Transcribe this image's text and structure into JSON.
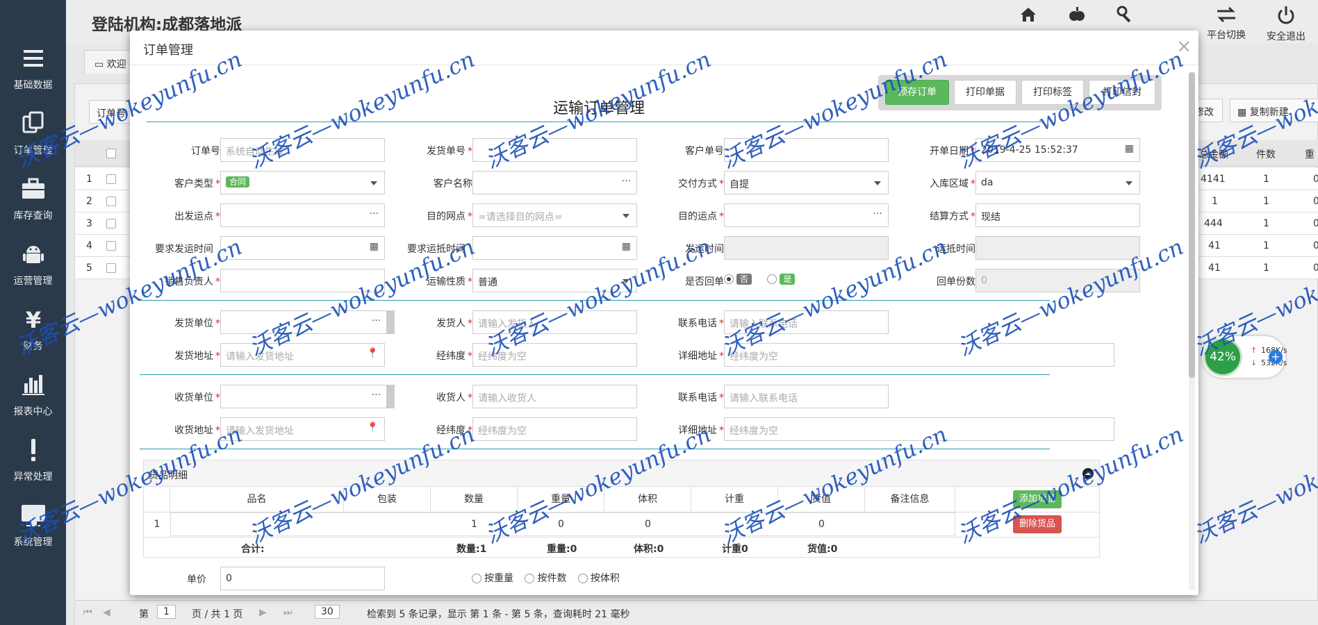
{
  "topbar": {
    "org": "登陆机构:成都落地派",
    "buttons": [
      {
        "label": ""
      },
      {
        "label": ""
      },
      {
        "label": ""
      },
      {
        "label": "平台切换"
      },
      {
        "label": "安全退出"
      }
    ]
  },
  "sidebar": {
    "items": [
      {
        "label": "基础数据",
        "icon": "menu-icon"
      },
      {
        "label": "订单管理",
        "icon": "orders-icon"
      },
      {
        "label": "库存查询",
        "icon": "briefcase-icon"
      },
      {
        "label": "运营管理",
        "icon": "android-icon"
      },
      {
        "label": "财务",
        "icon": "yen-icon"
      },
      {
        "label": "报表中心",
        "icon": "bar-chart-icon"
      },
      {
        "label": "异常处理",
        "icon": "exclamation-icon"
      },
      {
        "label": "系统管理",
        "icon": "monitor-icon"
      }
    ]
  },
  "background": {
    "tab": "欢迎",
    "filter_label": "订单号",
    "right_buttons": [
      "修改",
      "复制新建"
    ],
    "columns": [
      "总金额",
      "件数",
      "重"
    ],
    "rows": [
      {
        "no": "1",
        "amount": "4141",
        "count": "1",
        "w": "0"
      },
      {
        "no": "2",
        "amount": "1",
        "count": "1",
        "w": "0"
      },
      {
        "no": "3",
        "amount": "444",
        "count": "1",
        "w": "0"
      },
      {
        "no": "4",
        "amount": "41",
        "count": "1",
        "w": "0"
      },
      {
        "no": "5",
        "amount": "41",
        "count": "1",
        "w": "0"
      }
    ],
    "pager": {
      "page_prefix": "第",
      "page": "1",
      "page_suffix": "页 / 共 1 页",
      "size": "30",
      "summary": "检索到 5 条记录，显示 第 1 条 - 第 5 条，查询耗时 21 毫秒"
    }
  },
  "network": {
    "percent": "42%",
    "up": "168K/s",
    "down": "532K/s"
  },
  "modal": {
    "title": "订单管理",
    "close": "×",
    "actions": [
      "预存订单",
      "打印单据",
      "打印标签",
      "打印信封"
    ],
    "form_title": "运输订单管理",
    "fields": {
      "order_no": {
        "label": "订单号",
        "placeholder": "系统自动生成"
      },
      "ship_no": {
        "label": "发货单号",
        "value": ""
      },
      "cust_no": {
        "label": "客户单号",
        "value": ""
      },
      "open_date": {
        "label": "开单日期",
        "value": "2019-4-25 15:52:37"
      },
      "cust_type": {
        "label": "客户类型",
        "value": "合同"
      },
      "cust_name": {
        "label": "客户名称",
        "suffix": "···"
      },
      "pay_mode": {
        "label": "交付方式",
        "value": "自提"
      },
      "in_area": {
        "label": "入库区域",
        "value": "da"
      },
      "from_site": {
        "label": "出发运点",
        "suffix": "···"
      },
      "dest_net": {
        "label": "目的网点",
        "placeholder": "=请选择目的网点="
      },
      "dest_site": {
        "label": "目的运点",
        "suffix": "···"
      },
      "settle": {
        "label": "结算方式",
        "value": "现结"
      },
      "req_ship_time": {
        "label": "要求发运时间"
      },
      "req_arrive_time": {
        "label": "要求运抵时间"
      },
      "ship_time": {
        "label": "发运时间"
      },
      "arrive_time": {
        "label": "运抵时间"
      },
      "sales": {
        "label": "销售负责人"
      },
      "transport": {
        "label": "运输性质",
        "value": "普通"
      },
      "receipt": {
        "label": "是否回单",
        "no": "否",
        "yes": "是"
      },
      "receipt_count": {
        "label": "回单份数",
        "value": "0"
      },
      "sender_unit": {
        "label": "发货单位",
        "suffix": "···"
      },
      "sender": {
        "label": "发货人",
        "placeholder": "请输入发货人"
      },
      "sender_phone": {
        "label": "联系电话",
        "placeholder": "请输入联系电话"
      },
      "sender_addr": {
        "label": "发货地址",
        "placeholder": "请输入发货地址"
      },
      "sender_geo": {
        "label": "经纬度",
        "placeholder": "经纬度为空"
      },
      "sender_detail": {
        "label": "详细地址",
        "placeholder": "经纬度为空"
      },
      "recv_unit": {
        "label": "收货单位",
        "suffix": "···"
      },
      "recv": {
        "label": "收货人",
        "placeholder": "请输入收货人"
      },
      "recv_phone": {
        "label": "联系电话",
        "placeholder": "请输入联系电话"
      },
      "recv_addr": {
        "label": "收货地址",
        "placeholder": "请输入发货地址"
      },
      "recv_geo": {
        "label": "经纬度",
        "placeholder": "经纬度为空"
      },
      "recv_detail": {
        "label": "详细地址",
        "placeholder": "经纬度为空"
      }
    },
    "goods": {
      "title": "货品明细",
      "columns": [
        "品名",
        "包装",
        "数量",
        "重量",
        "体积",
        "计重",
        "货值",
        "备注信息"
      ],
      "add_btn": "添加货品",
      "del_btn": "删除货品",
      "row": {
        "no": "1",
        "qty": "1",
        "weight": "0",
        "volume": "0",
        "value": "0"
      },
      "sum": {
        "label": "合计:",
        "qty": "数量:1",
        "weight": "重量:0",
        "volume": "体积:0",
        "calc": "计重0",
        "value": "货值:0"
      }
    },
    "price": {
      "label": "单价",
      "value": "0"
    },
    "price_modes": [
      "按重量",
      "按件数",
      "按体积"
    ]
  },
  "watermark": "沃客云—wokeyunfu.cn"
}
